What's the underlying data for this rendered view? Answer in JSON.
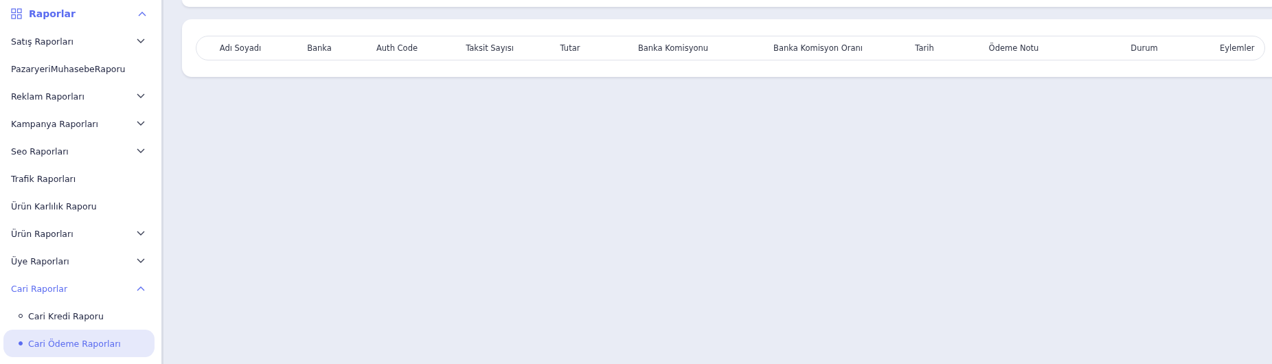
{
  "sidebar": {
    "section": {
      "label": "Raporlar",
      "expanded": true
    },
    "items": [
      {
        "kind": "group",
        "label": "Satış Raporları",
        "expanded": false
      },
      {
        "kind": "link",
        "label": "PazaryeriMuhasebeRaporu"
      },
      {
        "kind": "group",
        "label": "Reklam Raporları",
        "expanded": false
      },
      {
        "kind": "group",
        "label": "Kampanya Raporları",
        "expanded": false
      },
      {
        "kind": "group",
        "label": "Seo Raporları",
        "expanded": false
      },
      {
        "kind": "link",
        "label": "Trafik Raporları"
      },
      {
        "kind": "link",
        "label": "Ürün Karlılık Raporu"
      },
      {
        "kind": "group",
        "label": "Ürün Raporları",
        "expanded": false
      },
      {
        "kind": "group",
        "label": "Üye Raporları",
        "expanded": false
      },
      {
        "kind": "group",
        "label": "Cari Raporlar",
        "expanded": true,
        "children": [
          {
            "label": "Cari Kredi Raporu",
            "selected": false
          },
          {
            "label": "Cari Ödeme Raporları",
            "selected": true
          }
        ]
      }
    ]
  },
  "table": {
    "columns": [
      "Adı Soyadı",
      "Banka",
      "Auth Code",
      "Taksit Sayısı",
      "Tutar",
      "Banka Komisyonu",
      "Banka Komisyon Oranı",
      "Tarih",
      "Ödeme Notu",
      "Durum",
      "Eylemler"
    ]
  }
}
